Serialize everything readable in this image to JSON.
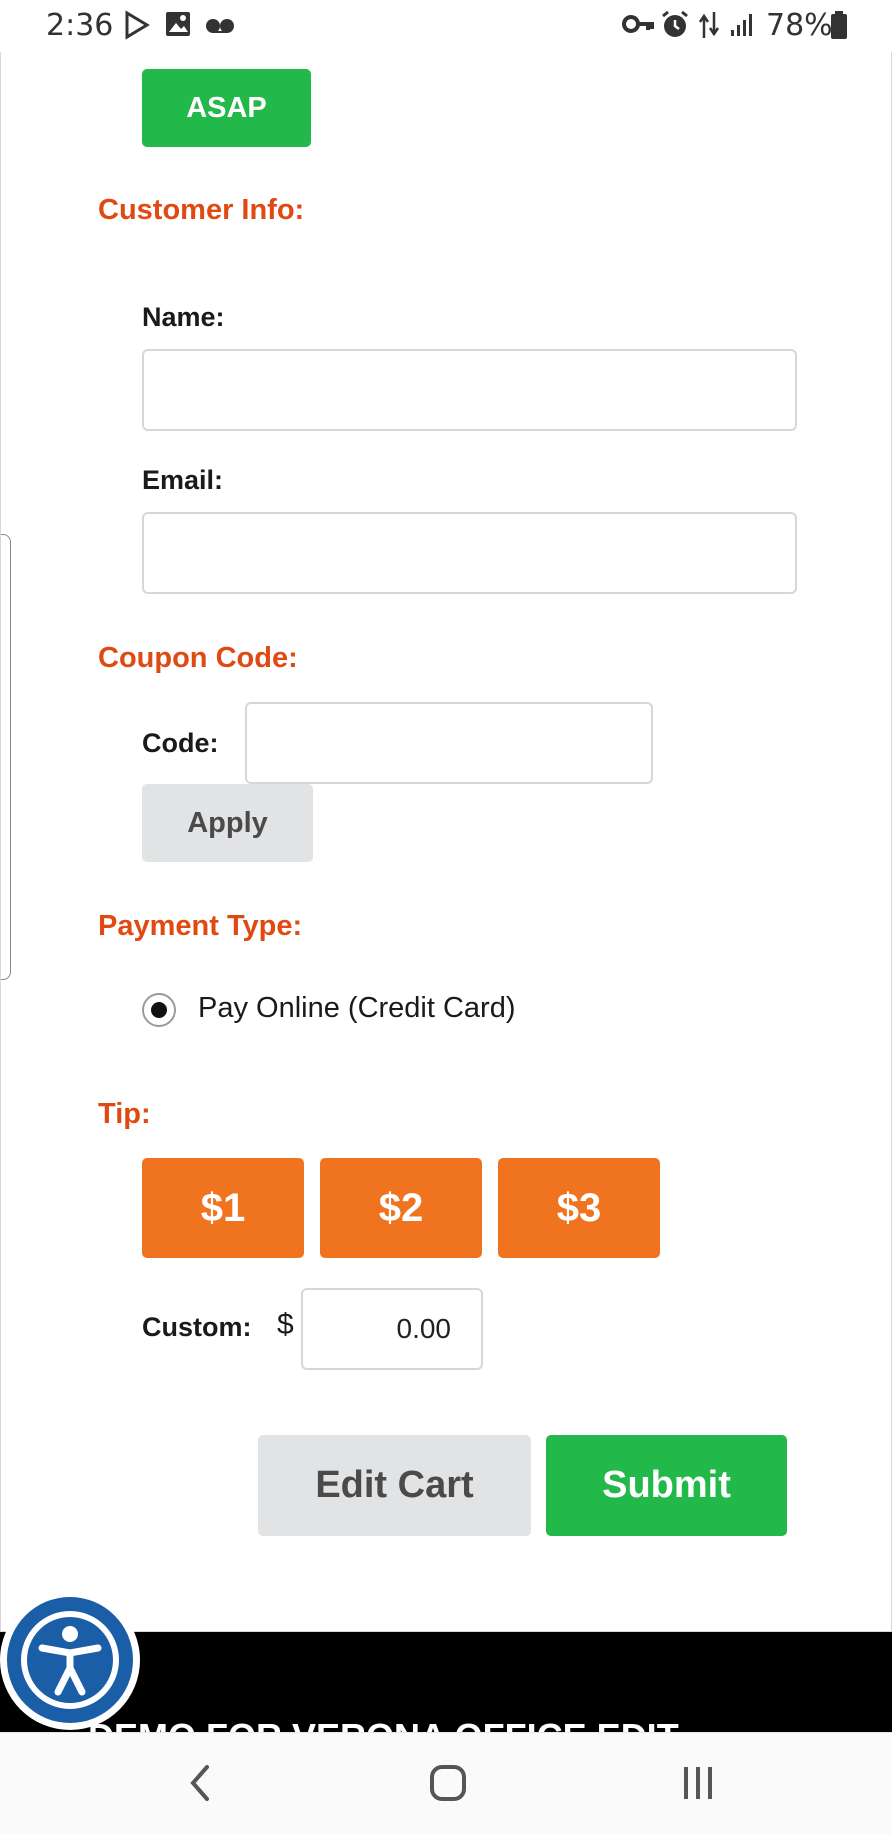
{
  "status_bar": {
    "time": "2:36",
    "battery": "78%",
    "icons": [
      "play-store-icon",
      "image-icon",
      "voicemail-icon",
      "vpn-key-icon",
      "alarm-icon",
      "data-transfer-icon",
      "signal-icon",
      "battery-icon"
    ]
  },
  "order": {
    "asap_label": "ASAP"
  },
  "customer_info": {
    "title": "Customer Info:",
    "name_label": "Name:",
    "name_value": "",
    "email_label": "Email:",
    "email_value": ""
  },
  "coupon": {
    "title": "Coupon Code:",
    "code_label": "Code:",
    "code_value": "",
    "apply_label": "Apply"
  },
  "payment": {
    "title": "Payment Type:",
    "option_label": "Pay Online (Credit Card)",
    "selected": true
  },
  "tip": {
    "title": "Tip:",
    "options": [
      "$1",
      "$2",
      "$3"
    ],
    "custom_label": "Custom:",
    "currency": "$",
    "custom_value": "0.00"
  },
  "actions": {
    "edit_cart_label": "Edit Cart",
    "submit_label": "Submit"
  },
  "footer": {
    "text": "DEMO FOR VERONA OFFICE EDIT"
  },
  "colors": {
    "accent_green": "#22b84a",
    "accent_orange": "#f07320",
    "section_red": "#e04a12",
    "a11y_blue": "#1b5ea8"
  }
}
